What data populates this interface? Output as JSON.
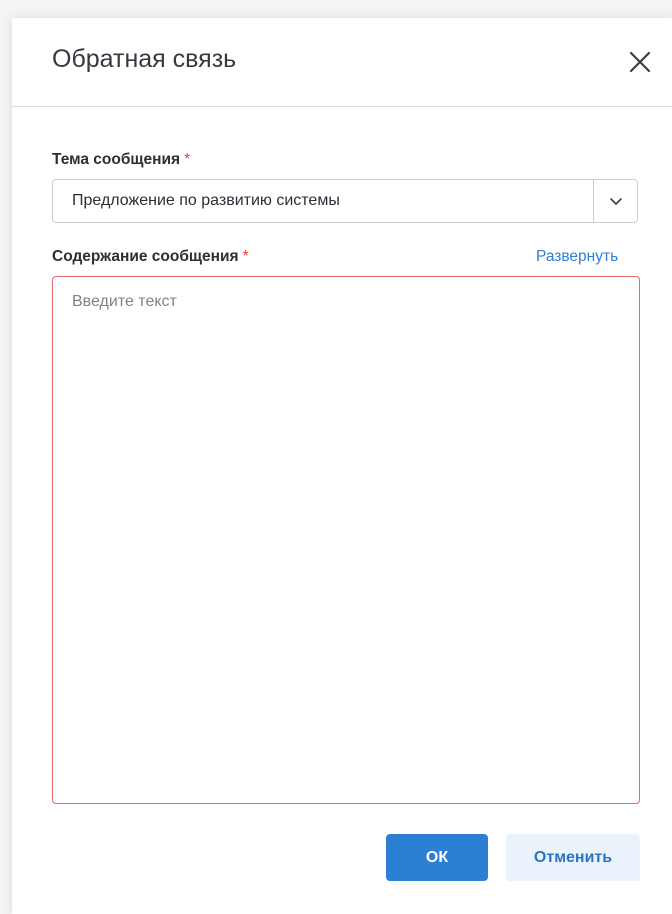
{
  "dialog": {
    "title": "Обратная связь",
    "close_icon": "close-icon"
  },
  "form": {
    "subject": {
      "label": "Тема сообщения",
      "required_mark": "*",
      "value": "Предложение по развитию системы",
      "dropdown_icon": "chevron-down-icon"
    },
    "content": {
      "label": "Содержание сообщения",
      "required_mark": "*",
      "expand_link": "Развернуть",
      "placeholder": "Введите текст",
      "value": ""
    }
  },
  "actions": {
    "ok_label": "ОК",
    "cancel_label": "Отменить"
  },
  "colors": {
    "primary": "#2b80d4",
    "required": "#e0423a",
    "error_border": "#e36a66",
    "link": "#2f80d1",
    "secondary_button_bg": "#eaf2fb"
  }
}
